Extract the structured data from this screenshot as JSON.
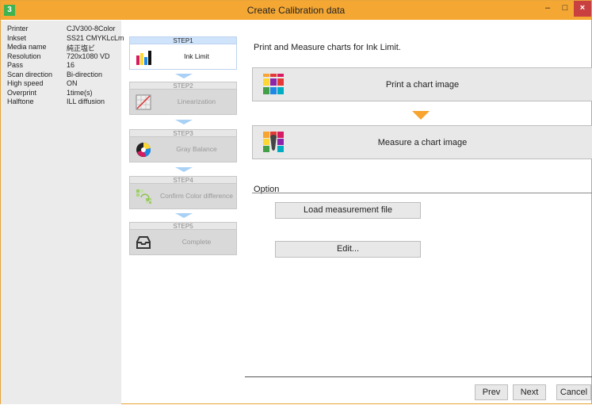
{
  "window": {
    "title": "Create Calibration data",
    "app_icon": "3",
    "minimize": "–",
    "maximize": "□",
    "close": "×"
  },
  "info": [
    {
      "key": "Printer",
      "value": "CJV300-8Color"
    },
    {
      "key": "Inkset",
      "value": "SS21 CMYKLcLm"
    },
    {
      "key": "Media name",
      "value": "純正塩ビ"
    },
    {
      "key": "Resolution",
      "value": "720x1080 VD"
    },
    {
      "key": "Pass",
      "value": "16"
    },
    {
      "key": "Scan direction",
      "value": "Bi-direction"
    },
    {
      "key": "High speed",
      "value": "ON"
    },
    {
      "key": "Overprint",
      "value": "1time(s)"
    },
    {
      "key": "Halftone",
      "value": "ILL diffusion"
    }
  ],
  "steps": [
    {
      "head": "STEP1",
      "label": "Ink Limit",
      "icon": "ink-bars-icon",
      "state": "active"
    },
    {
      "head": "STEP2",
      "label": "Linearization",
      "icon": "linearization-icon",
      "state": "inactive"
    },
    {
      "head": "STEP3",
      "label": "Gray Balance",
      "icon": "color-wheel-icon",
      "state": "inactive"
    },
    {
      "head": "STEP4",
      "label": "Confirm Color difference",
      "icon": "color-compare-icon",
      "state": "inactive"
    },
    {
      "head": "STEP5",
      "label": "Complete",
      "icon": "tray-icon",
      "state": "inactive"
    }
  ],
  "main": {
    "heading": "Print and Measure charts for Ink Limit.",
    "print_button": "Print a chart image",
    "measure_button": "Measure a chart image",
    "option_label": "Option",
    "load_button": "Load measurement file",
    "edit_button": "Edit..."
  },
  "nav": {
    "prev": "Prev",
    "next": "Next",
    "cancel": "Cancel"
  },
  "colors": {
    "titlebar": "#f5a733",
    "active_step": "#cfe3fa",
    "arrow": "#f7a431"
  }
}
